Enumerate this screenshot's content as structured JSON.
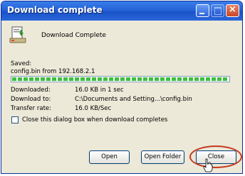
{
  "window": {
    "title": "Download complete"
  },
  "header": {
    "text": "Download Complete"
  },
  "saved": {
    "label": "Saved:",
    "file": "config.bin from 192.168.2.1",
    "progress": 1.0
  },
  "details": [
    {
      "label": "Downloaded:",
      "value": "16.0 KB in 1 sec"
    },
    {
      "label": "Download to:",
      "value": "C:\\Documents and Setting...\\config.bin"
    },
    {
      "label": "Transfer rate:",
      "value": "16.0 KB/Sec"
    }
  ],
  "options": {
    "close_when_done": {
      "label": "Close this dialog box when download completes",
      "checked": false
    }
  },
  "buttons": {
    "open": "Open",
    "open_folder": "Open Folder",
    "close": "Close"
  },
  "colors": {
    "titlebar": "#2563d9",
    "progress": "#3fbf3f",
    "highlight": "#c8381f"
  },
  "icons": {
    "download": "download-icon",
    "cursor": "hand-cursor-icon"
  }
}
